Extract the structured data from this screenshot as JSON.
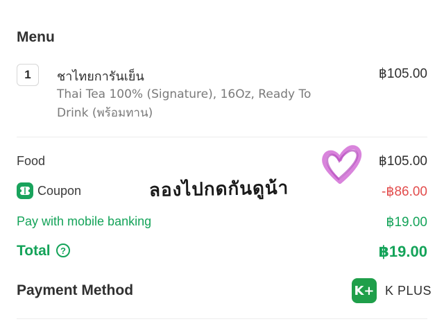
{
  "menu": {
    "title": "Menu",
    "item": {
      "quantity": "1",
      "name": "ชาไทยการันเย็น",
      "description": "Thai Tea 100% (Signature), 16Oz, Ready To Drink (พร้อมทาน)",
      "price": "฿105.00"
    }
  },
  "summary": {
    "food_label": "Food",
    "food_value": "฿105.00",
    "coupon_label": "Coupon",
    "coupon_value": "-฿86.00",
    "mobile_banking_label": "Pay with mobile banking",
    "mobile_banking_value": "฿19.00",
    "total_label": "Total",
    "total_value": "฿19.00"
  },
  "payment": {
    "label": "Payment Method",
    "method_logo_text": "K+",
    "method_name": "K PLUS"
  },
  "overlay": {
    "handwritten_text": "ลองไปกดกันดูน้า"
  },
  "colors": {
    "green": "#14a359",
    "red": "#e24b4b",
    "heart": "#d26fd6"
  },
  "icons": {
    "coupon": "coupon-ticket-icon",
    "info": "question-circle-icon",
    "payment": "kplus-logo",
    "doodle": "heart-doodle"
  }
}
